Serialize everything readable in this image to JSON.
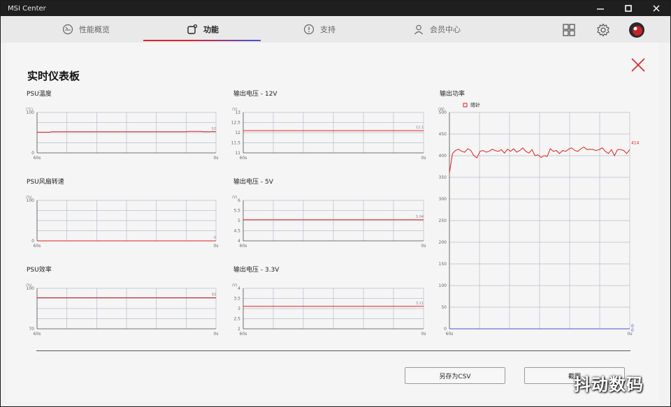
{
  "window": {
    "title": "MSI Center"
  },
  "nav": {
    "tabs": [
      {
        "label": "性能概览"
      },
      {
        "label": "功能"
      },
      {
        "label": "支持"
      },
      {
        "label": "会员中心"
      }
    ]
  },
  "page": {
    "title": "实时仪表板"
  },
  "buttons": {
    "save_csv": "另存为CSV",
    "screenshot": "截图"
  },
  "watermark": "抖动数码",
  "colors": {
    "accent": "#d6262e",
    "grid": "#b8bccf",
    "series": "#e02020"
  },
  "chart_data": [
    {
      "type": "line",
      "title": "PSU温度",
      "unit": "(°C)",
      "ylim": [
        0,
        100
      ],
      "yticks": [
        "100",
        "0"
      ],
      "x_start": "60s",
      "x_end": "0s",
      "current": "52",
      "series": [
        {
          "values": [
            51,
            51,
            51,
            51,
            51,
            52,
            52,
            52,
            52,
            52,
            52,
            52,
            52,
            52,
            52,
            52,
            52,
            52,
            52,
            52,
            52,
            52,
            52,
            52,
            52,
            52,
            52,
            52,
            52,
            52,
            52,
            52,
            52,
            52,
            52,
            52,
            52,
            52,
            52,
            52,
            52,
            52,
            52,
            52,
            52,
            52,
            52,
            52,
            52,
            52,
            53,
            53,
            53,
            53,
            53,
            52,
            52,
            52,
            53,
            52
          ]
        }
      ]
    },
    {
      "type": "line",
      "title": "输出电压 - 12V",
      "unit": "(V)",
      "ylim": [
        11,
        13
      ],
      "yticks": [
        "13",
        "12.5",
        "12",
        "11.5",
        "11"
      ],
      "x_start": "60s",
      "x_end": "0s",
      "current": "12.1",
      "series": [
        {
          "values": [
            12.1,
            12.1,
            12.1,
            12.1,
            12.1,
            12.1,
            12.1,
            12.1,
            12.1,
            12.1,
            12.1,
            12.1,
            12.1,
            12.1,
            12.1,
            12.1,
            12.1,
            12.1,
            12.1,
            12.1
          ]
        }
      ]
    },
    {
      "type": "line",
      "title": "PSU风扇转速",
      "unit": "(%)",
      "ylim": [
        0,
        100
      ],
      "yticks": [
        "100",
        "0"
      ],
      "x_start": "60s",
      "x_end": "0s",
      "current": "0",
      "series": [
        {
          "values": [
            0,
            0,
            0,
            0,
            0,
            0,
            0,
            0,
            0,
            0,
            0,
            0,
            0,
            0,
            0,
            0,
            0,
            0,
            0,
            0
          ]
        }
      ]
    },
    {
      "type": "line",
      "title": "输出电压 - 5V",
      "unit": "(V)",
      "ylim": [
        4,
        6
      ],
      "yticks": [
        "6",
        "5.5",
        "5",
        "4.5",
        "4"
      ],
      "x_start": "60s",
      "x_end": "0s",
      "current": "5.04",
      "series": [
        {
          "values": [
            5.04,
            5.04,
            5.04,
            5.04,
            5.04,
            5.04,
            5.04,
            5.04,
            5.04,
            5.04,
            5.04,
            5.04,
            5.04,
            5.04,
            5.04,
            5.04,
            5.04,
            5.04,
            5.04,
            5.04
          ]
        }
      ]
    },
    {
      "type": "line",
      "title": "PSU效率",
      "unit": "(%)",
      "ylim": [
        70,
        100
      ],
      "yticks": [
        "100",
        "70"
      ],
      "x_start": "60s",
      "x_end": "0s",
      "current": "93",
      "series": [
        {
          "values": [
            93,
            93,
            93,
            93,
            93,
            93,
            93,
            93,
            93,
            93,
            93,
            93,
            93,
            93,
            93,
            93,
            93,
            93,
            93,
            93
          ]
        }
      ]
    },
    {
      "type": "line",
      "title": "输出电压 - 3.3V",
      "unit": "(V)",
      "ylim": [
        2,
        4
      ],
      "yticks": [
        "4",
        "3.5",
        "3",
        "2.5",
        "2"
      ],
      "x_start": "60s",
      "x_end": "0s",
      "current": "3.11",
      "series": [
        {
          "values": [
            3.11,
            3.11,
            3.11,
            3.11,
            3.11,
            3.11,
            3.11,
            3.11,
            3.11,
            3.11,
            3.11,
            3.11,
            3.11,
            3.11,
            3.11,
            3.11,
            3.11,
            3.11,
            3.11,
            3.11
          ]
        }
      ]
    },
    {
      "type": "line",
      "title": "输出功率",
      "unit": "(W)",
      "ylim": [
        0,
        500
      ],
      "yticks": [
        "500",
        "450",
        "400",
        "350",
        "300",
        "250",
        "200",
        "150",
        "100",
        "50",
        "0"
      ],
      "x_start": "60s",
      "x_end": "0s",
      "current": "414",
      "current_secondary": "0",
      "current_secondary2": "0",
      "legend": "總計",
      "series": [
        {
          "name": "總計",
          "values": [
            360,
            405,
            412,
            415,
            410,
            408,
            416,
            412,
            400,
            395,
            410,
            412,
            408,
            410,
            415,
            412,
            410,
            414,
            406,
            415,
            410,
            416,
            408,
            412,
            418,
            410,
            406,
            414,
            400,
            402,
            396,
            400,
            398,
            416,
            410,
            412,
            405,
            412,
            410,
            415,
            418,
            412,
            410,
            416,
            420,
            414,
            415,
            414,
            412,
            414,
            418,
            410,
            405,
            414,
            400,
            414,
            414,
            412,
            405,
            414
          ]
        }
      ]
    }
  ]
}
